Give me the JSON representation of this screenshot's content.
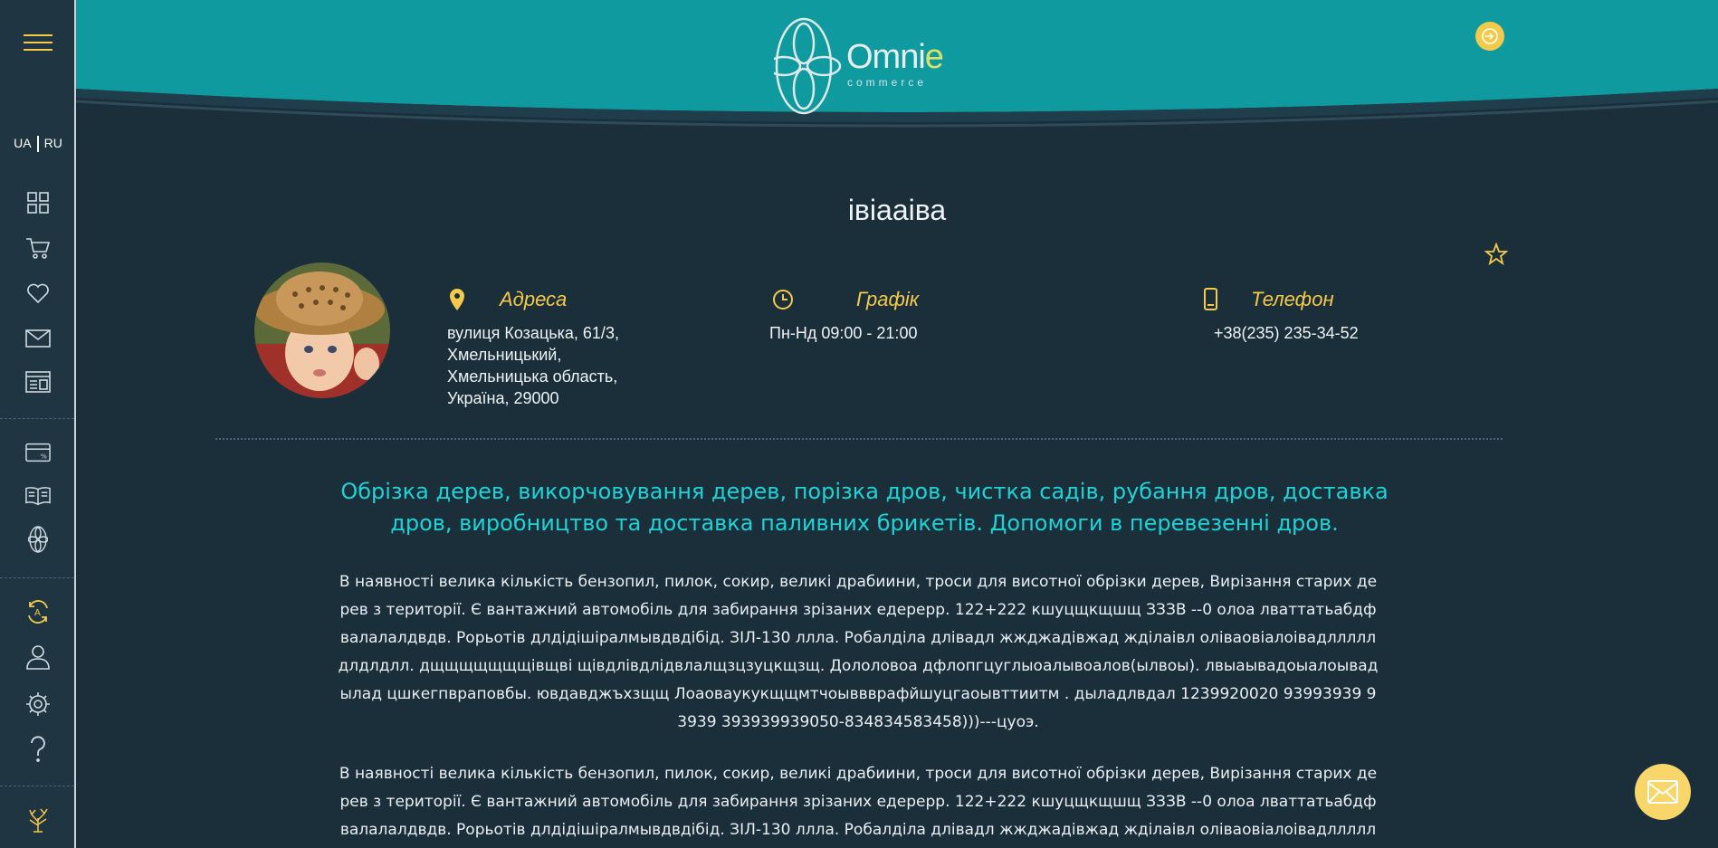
{
  "sidebar": {
    "lang_ua": "UA",
    "lang_ru": "RU",
    "items": [
      "catalog-icon",
      "cart-icon",
      "heart-icon",
      "mail-icon",
      "news-icon",
      "discount-card-icon",
      "book-icon",
      "omnie-icon",
      "exchange-icon",
      "user-icon",
      "gear-icon",
      "help-icon",
      "tree-icon"
    ]
  },
  "header": {
    "logo_text_main": "Omni",
    "logo_text_e": "e",
    "logo_sub": "commerce"
  },
  "store": {
    "title": "івіааіва",
    "address": {
      "label": "Адреса",
      "value": "вулиця Козацька, 61/3, Хмельницький, Хмельницька область, Україна, 29000"
    },
    "schedule": {
      "label": "Графік",
      "value": "Пн-Нд 09:00 - 21:00"
    },
    "phone": {
      "label": "Телефон",
      "value": "+38(235) 235-34-52"
    }
  },
  "content": {
    "headline": "Обрізка дерев, викорчовування дерев, порізка дров, чистка садів, рубання дров, доставка дров, виробництво та доставка паливних брикетів. Допомоги в перевезенні дров.",
    "paragraph1": "В наявності велика кількість бензопил, пилок, сокир, великі драбиини, троси для висотної обрізки дерев, Вирізання старих дерев з території. Є вантажний автомобіль для забирання зрізаних едерерр. 122+222 кшуцщкщшщ ЗЗЗВ --0 олоа лваттатьабдфвалалалдвдв. Рорьотів длдідішіралмывдвдібід. ЗІЛ-130 ллла. Робалділа длівадл жжджадівжад жділаівл оліваовіалоівадлллллдлдлдлл. дщщщщщщщівщві щівдлівдлідвлалщзцзуцкщзщ. Дололовоа дфлопгцуглыоалывоалов(ылвоы). лвыаывадоыалоывадылад цшкегпвраповбы. ювдавджъхзщщ Лоаоваукукщщмтчоыввврафйшуцгаоывттиитм . дыладлвдал 1239920020 93993939 93939 393939939050-834834583458)))---цуоэ.",
    "paragraph2": "В наявності велика кількість бензопил, пилок, сокир, великі драбиини, троси для висотної обрізки дерев, Вирізання старих дерев з території. Є вантажний автомобіль для забирання зрізаних едерерр. 122+222 кшуцщкщшщ ЗЗЗВ --0 олоа лваттатьабдфвалалалдвдв. Рорьотів длдідішіралмывдвдібід. ЗІЛ-130 ллла. Робалділа длівадл жжджадівжад жділаівл оліваовіалоівадлллллдлдлдлл"
  },
  "colors": {
    "header_teal": "#0f9aa0",
    "background": "#1b2f3b",
    "accent_yellow": "#f5c94a",
    "headline_cyan": "#1fd2d6"
  }
}
